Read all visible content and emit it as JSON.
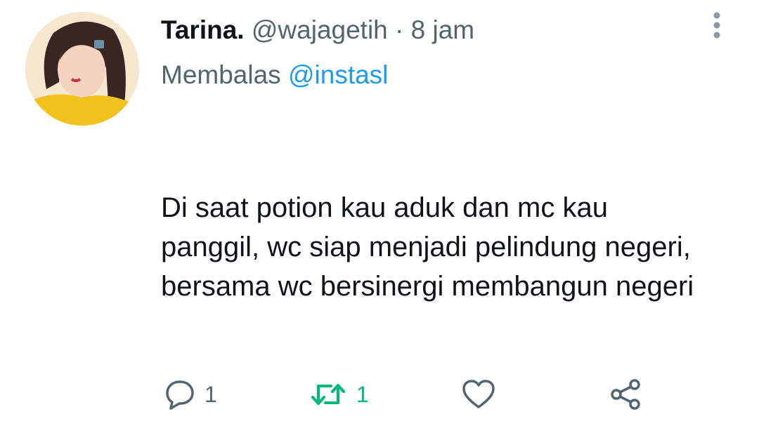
{
  "tweet": {
    "author_name": "Tarina.",
    "author_handle": "@wajagetih",
    "separator": "·",
    "time": "8 jam",
    "reply_prefix": "Membalas",
    "reply_to": "@instasl",
    "text": "Di saat potion kau aduk dan mc kau panggil, wc siap menjadi pelindung negeri, bersama wc bersinergi membangun negeri"
  },
  "actions": {
    "reply": {
      "icon": "reply-icon",
      "count": "1"
    },
    "retweet": {
      "icon": "retweet-icon",
      "count": "1",
      "color": "#00ba7c"
    },
    "like": {
      "icon": "heart-icon"
    },
    "share": {
      "icon": "share-icon"
    }
  },
  "colors": {
    "text": "#0f1419",
    "secondary": "#536471",
    "accent": "#1d9bf0",
    "retweet_active": "#00ba7c"
  }
}
